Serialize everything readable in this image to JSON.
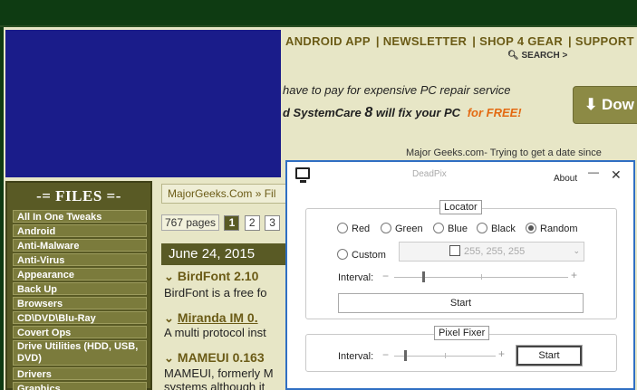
{
  "site": {
    "nav": [
      "ANDROID APP",
      "NEWSLETTER",
      "SHOP 4 GEAR",
      "SUPPORT F"
    ],
    "search_label": "SEARCH >",
    "ad_line1": "have to pay for expensive PC repair service",
    "ad_line2_a": "d SystemCare",
    "ad_line2_num": "8",
    "ad_line2_b": "will fix your PC",
    "ad_free": "for FREE!",
    "download_label": "Dow",
    "tagline": "Major Geeks.com- Trying to get a date since",
    "files_title": "-= FILES =-",
    "categories": [
      "All In One Tweaks",
      "Android",
      "Anti-Malware",
      "Anti-Virus",
      "Appearance",
      "Back Up",
      "Browsers",
      "CD\\DVD\\Blu-Ray",
      "Covert Ops",
      "Drive Utilities (HDD, USB, DVD)",
      "Drivers",
      "Graphics"
    ],
    "breadcrumb": "MajorGeeks.Com » Fil",
    "page_count": "767 pages",
    "pages": [
      "1",
      "2",
      "3"
    ],
    "date": "June 24, 2015",
    "articles": [
      {
        "title": "BirdFont 2.10",
        "desc": "BirdFont is a free fo"
      },
      {
        "title": "Miranda IM 0.",
        "desc": "A multi protocol inst"
      },
      {
        "title": "MAMEUI 0.163",
        "desc": "MAMEUI, formerly M"
      }
    ],
    "article_extra": "systems although it"
  },
  "deadpix": {
    "title": "DeadPix",
    "about": "About",
    "minimize": "—",
    "close": "✕",
    "locator": {
      "label": "Locator",
      "options": [
        "Red",
        "Green",
        "Blue",
        "Black",
        "Random"
      ],
      "selected": "Random",
      "custom": "Custom",
      "color_value": "255, 255, 255",
      "interval_label": "Interval:",
      "interval_level": 0.16,
      "start": "Start"
    },
    "fixer": {
      "label": "Pixel Fixer",
      "interval_label": "Interval:",
      "interval_level": 0.1,
      "start": "Start"
    }
  }
}
